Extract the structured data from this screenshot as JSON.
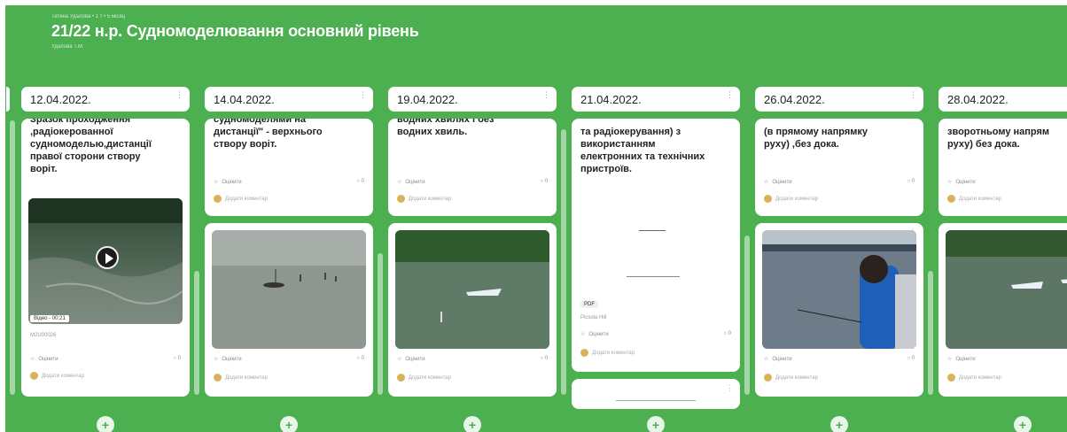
{
  "header": {
    "meta": "Тетяна Удалова • 1 т • 5 місяц",
    "title": "21/22 н.р. Судномоделювання основний рівень",
    "author": "Удалова Т.М."
  },
  "columns": [
    {
      "date": "12.04.2022.",
      "text": "Зразок проходження\n,радіокерованної\nсудномоделью,дистанції\nправої сторони створу\nворіт.",
      "media_label": "Відео - 00:21",
      "media_sub": "M2U00026",
      "react_label": "Оцінити",
      "count": "0",
      "comment_placeholder": "Додати коментар"
    },
    {
      "date": "14.04.2022.",
      "text": "судномоделями на\nдистанції\" - верхнього\nстворy воріт.",
      "react_label": "Оцінити",
      "count": "0",
      "comment_placeholder": "Додати коментар"
    },
    {
      "date": "19.04.2022.",
      "text": "водних хвилях і без\nводних хвиль.",
      "react_label": "Оцінити",
      "count": "0",
      "comment_placeholder": "Додати коментар"
    },
    {
      "date": "21.04.2022.",
      "text": "та радіокерування) з\nвикористанням\nелектронних та технічних\nпристроїв.",
      "pdf_badge": "PDF",
      "pdf_sub": "Picsola Hill",
      "react_label": "Оцінити",
      "count": "0",
      "comment_placeholder": "Додати коментар"
    },
    {
      "date": "26.04.2022.",
      "text": "(в прямому напрямку\nруху) ,без дока.",
      "react_label": "Оцінити",
      "count": "0",
      "comment_placeholder": "Додати коментар"
    },
    {
      "date": "28.04.2022.",
      "text": "зворотньому напрям\nруху) без дока.",
      "react_label": "Оцінити",
      "count": "0",
      "comment_placeholder": "Додати коментар"
    }
  ],
  "icons": {
    "add": "plus-icon",
    "menu": "kebab-icon",
    "star": "star-icon",
    "comment": "comment-icon",
    "play": "play-icon"
  },
  "colors": {
    "board": "#4caf50",
    "card": "#ffffff",
    "scroll": "#a5d6a7"
  }
}
